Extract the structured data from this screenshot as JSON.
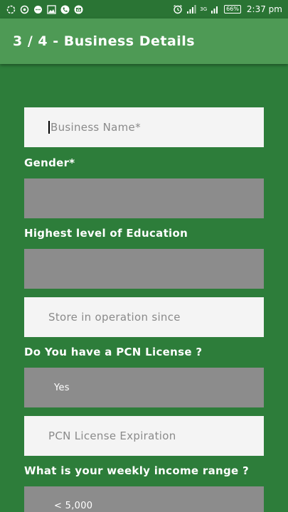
{
  "status_bar": {
    "battery": "66%",
    "network": "3G",
    "time": "2:37 pm"
  },
  "app_bar": {
    "title": "3 / 4 - Business Details"
  },
  "form": {
    "business_name": {
      "placeholder": "Business Name*",
      "value": ""
    },
    "gender": {
      "label": "Gender*",
      "value": ""
    },
    "education": {
      "label": "Highest level of Education",
      "value": ""
    },
    "store_since": {
      "placeholder": "Store in operation since",
      "value": ""
    },
    "pcn_license": {
      "label": "Do You have a PCN License ?",
      "value": "Yes"
    },
    "pcn_expiration": {
      "placeholder": "PCN License Expiration",
      "value": ""
    },
    "weekly_income": {
      "label": "What is your weekly income range ?",
      "value": "< 5,000"
    }
  }
}
